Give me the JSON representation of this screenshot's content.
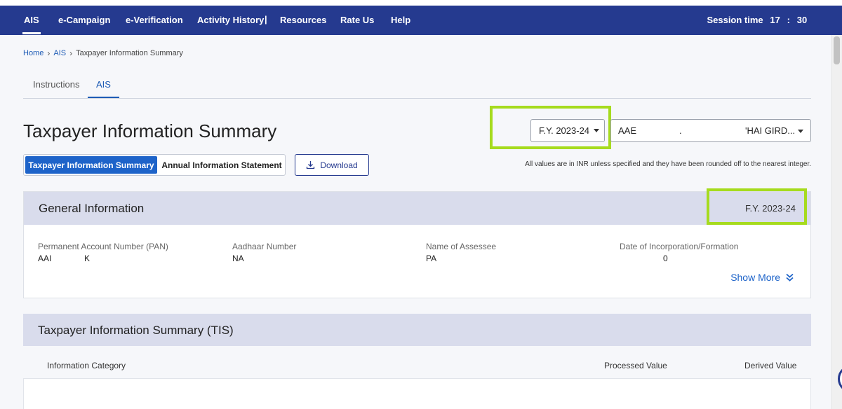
{
  "nav": {
    "items": [
      "AIS",
      "e-Campaign",
      "e-Verification",
      "Activity History",
      "Resources",
      "Rate Us",
      "Help"
    ],
    "separator": "|",
    "session_label": "Session time",
    "session_minutes": "17",
    "session_colon": ":",
    "session_seconds": "30"
  },
  "breadcrumb": {
    "home": "Home",
    "ais": "AIS",
    "current": "Taxpayer Information Summary"
  },
  "tabs": [
    "Instructions",
    "AIS"
  ],
  "page_title": "Taxpayer Information Summary",
  "fy_select": {
    "value": "F.Y. 2023-24"
  },
  "user_select": {
    "value_left": "AAE",
    "value_mid": ".",
    "value_right": "'HAI GIRD..."
  },
  "toggle": {
    "tis": "Taxpayer Information Summary",
    "ais": "Annual Information Statement"
  },
  "download_label": "Download",
  "note": "All values are in INR unless specified and they have been rounded off to the nearest integer.",
  "general_info": {
    "title": "General Information",
    "fy": "F.Y. 2023-24",
    "pan_label": "Permanent Account Number (PAN)",
    "pan_value_a": "AAI",
    "pan_value_b": "K",
    "aadhaar_label": "Aadhaar Number",
    "aadhaar_value": "NA",
    "name_label": "Name of Assessee",
    "name_value": "PA",
    "doi_label": "Date of Incorporation/Formation",
    "doi_value": "0",
    "show_more": "Show More"
  },
  "tis": {
    "title": "Taxpayer Information Summary (TIS)",
    "col_category": "Information Category",
    "col_processed": "Processed Value",
    "col_derived": "Derived Value"
  },
  "colors": {
    "navbar": "#253a8f",
    "highlight": "#a6db1e",
    "active_button": "#1d63c9",
    "card_header": "#d9dcec"
  }
}
